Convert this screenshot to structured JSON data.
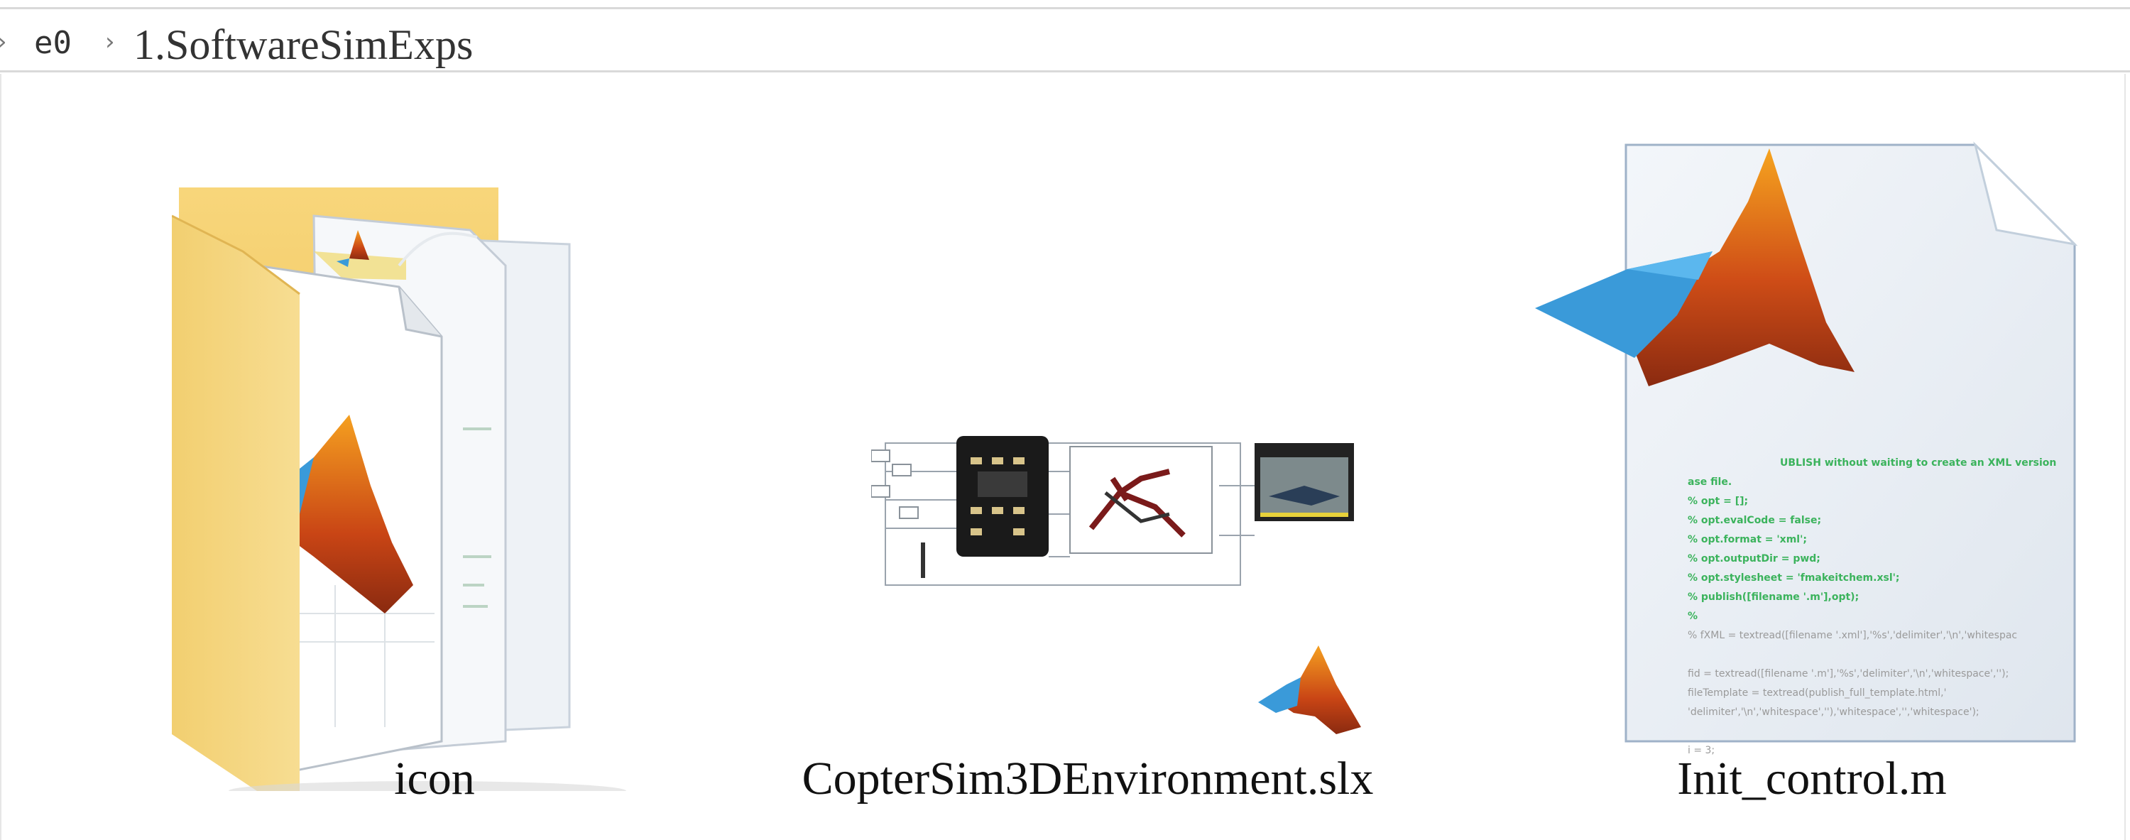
{
  "address_bar": {
    "crumbs": [
      {
        "label": "e0"
      },
      {
        "label": "1.SoftwareSimExps"
      }
    ]
  },
  "files": [
    {
      "name": "icon",
      "type": "folder",
      "icon": "matlab-folder-icon"
    },
    {
      "name": "CopterSim3DEnvironment.slx",
      "type": "simulink-model",
      "icon": "simulink-model-thumbnail"
    },
    {
      "name": "Init_control.m",
      "type": "matlab-script",
      "icon": "matlab-script-icon"
    }
  ],
  "script_preview": {
    "lines": [
      "UBLISH without waiting to create an XML version",
      "ase file.",
      "% opt = [];",
      "% opt.evalCode = false;",
      "% opt.format = 'xml';",
      "% opt.outputDir = pwd;",
      "% opt.stylesheet = 'fmakeitchem.xsl';",
      "% publish([filename '.m'],opt);",
      "%",
      "% fXML = textread([filename '.xml'],'%s','delimiter','\\n','whitespac",
      "",
      "fid = textread([filename '.m'],'%s','delimiter','\\n','whitespace','');",
      "fileTemplate = textread(publish_full_template.html,'",
      "'delimiter','\\n','whitespace',''),'whitespace','','whitespace');",
      "",
      "i = 3;"
    ]
  },
  "colors": {
    "folder_yellow": "#f6d874",
    "matlab_orange": "#d9531e",
    "matlab_blue": "#3a9ad9",
    "code_green": "#3bb35c",
    "code_gray": "#9a9a9a"
  }
}
